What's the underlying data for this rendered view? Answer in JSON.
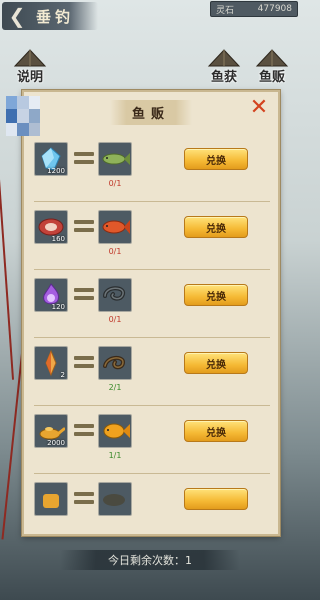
{
  "topbar": {
    "title": "垂钓",
    "currency_label": "灵石",
    "currency_value": "477908"
  },
  "side": {
    "left_label": "说明",
    "fish_catch_label": "鱼获",
    "fish_shop_label": "鱼贩"
  },
  "panel": {
    "title": "鱼贩",
    "close": "✕"
  },
  "rows": [
    {
      "cost_icon": "blue-crystal-icon",
      "cost_count": "1200",
      "reward_icon": "green-fish-icon",
      "progress": "0/1",
      "progress_color": "#c0392b",
      "button": "兑换"
    },
    {
      "cost_icon": "meat-icon",
      "cost_count": "160",
      "reward_icon": "red-fish-icon",
      "progress": "0/1",
      "progress_color": "#c0392b",
      "button": "兑换"
    },
    {
      "cost_icon": "purple-flame-icon",
      "cost_count": "120",
      "reward_icon": "eel-icon",
      "progress": "0/1",
      "progress_color": "#c0392b",
      "button": "兑换"
    },
    {
      "cost_icon": "spirit-crystal-icon",
      "cost_count": "2",
      "reward_icon": "brown-eel-icon",
      "progress": "2/1",
      "progress_color": "#3a8a2a",
      "button": "兑换"
    },
    {
      "cost_icon": "lamp-icon",
      "cost_count": "2000",
      "reward_icon": "golden-fish-icon",
      "progress": "1/1",
      "progress_color": "#3a8a2a",
      "button": "兑换"
    },
    {
      "cost_icon": "gold-item-icon",
      "cost_count": "",
      "reward_icon": "dark-fish-icon",
      "progress": "",
      "progress_color": "#3a8a2a",
      "button": ""
    }
  ],
  "footer": {
    "remaining_text": "今日剩余次数：1"
  }
}
